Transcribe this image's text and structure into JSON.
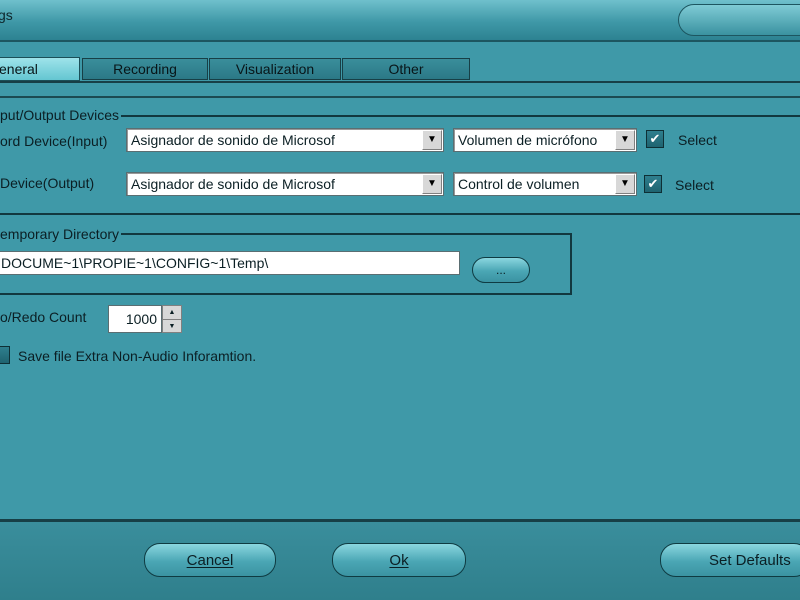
{
  "window": {
    "title": "gs"
  },
  "tabs": [
    {
      "label": "eneral",
      "active": true
    },
    {
      "label": "Recording",
      "active": false
    },
    {
      "label": "Visualization",
      "active": false
    },
    {
      "label": "Other",
      "active": false
    }
  ],
  "devices": {
    "group_label": "put/Output Devices",
    "input": {
      "label": "ord Device(Input)",
      "device": "Asignador de sonido de Microsof",
      "control": "Volumen de micrófono",
      "select_label": "Select",
      "select_checked": true
    },
    "output": {
      "label": "Device(Output)",
      "device": "Asignador de sonido de Microsof",
      "control": "Control de volumen",
      "select_label": "Select",
      "select_checked": true
    }
  },
  "temp": {
    "group_label": "emporary Directory",
    "path": "DOCUME~1\\PROPIE~1\\CONFIG~1\\Temp\\",
    "browse_label": "..."
  },
  "undo": {
    "label": "o/Redo Count",
    "value": "1000"
  },
  "save_extra": {
    "label": "Save file Extra Non-Audio Inforamtion.",
    "checked": true
  },
  "buttons": {
    "cancel": "Cancel",
    "ok": "Ok",
    "defaults": "Set Defaults"
  },
  "colors": {
    "background": "#3f99a8",
    "active_tab": "#9ee3ea",
    "input_bg": "#ffffff"
  }
}
